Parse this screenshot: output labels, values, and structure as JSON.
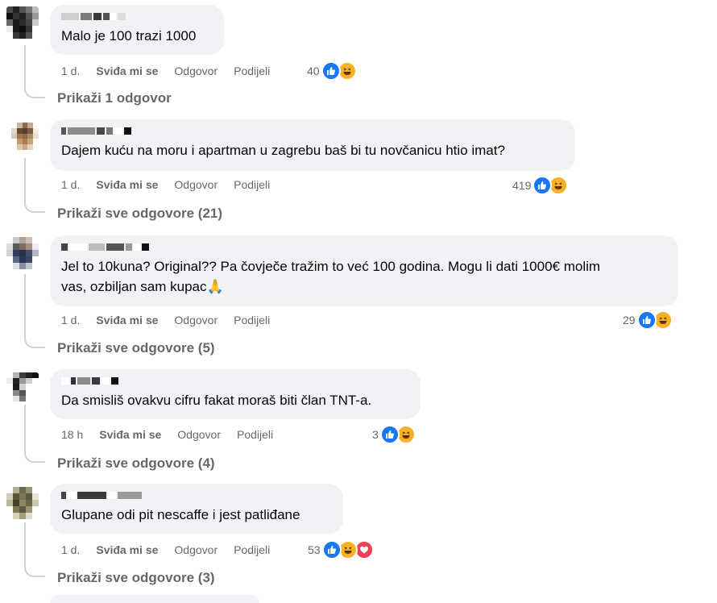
{
  "comments": [
    {
      "text": "Malo je 100 trazi 1000",
      "time": "1 d.",
      "like_label": "Sviđa mi se",
      "reply_label": "Odgovor",
      "share_label": "Podijeli",
      "reaction_count": "40",
      "reactions": [
        "like-icon",
        "haha-icon"
      ],
      "replies_label": "Prikaži 1 odgovor"
    },
    {
      "text": "Dajem kuću na moru i apartman u zagrebu baš bi tu novčanicu htio imat?",
      "time": "1 d.",
      "like_label": "Sviđa mi se",
      "reply_label": "Odgovor",
      "share_label": "Podijeli",
      "reaction_count": "419",
      "reactions": [
        "like-icon",
        "haha-icon"
      ],
      "replies_label": "Prikaži sve odgovore (21)"
    },
    {
      "text_line1": "Jel to 10kuna? Original?? Pa čovječe tražim to već 100 godina. Mogu li dati 1000€ molim",
      "text_line2": "vas, ozbiljan sam kupac🙏",
      "time": "1 d.",
      "like_label": "Sviđa mi se",
      "reply_label": "Odgovor",
      "share_label": "Podijeli",
      "reaction_count": "29",
      "reactions": [
        "like-icon",
        "haha-icon"
      ],
      "replies_label": "Prikaži sve odgovore (5)"
    },
    {
      "text": "Da smisliš ovakvu cifru fakat moraš biti član TNT-a.",
      "time": "18 h",
      "like_label": "Sviđa mi se",
      "reply_label": "Odgovor",
      "share_label": "Podijeli",
      "reaction_count": "3",
      "reactions": [
        "like-icon",
        "haha-icon"
      ],
      "replies_label": "Prikaži sve odgovore (4)"
    },
    {
      "text": "Glupane odi pit nescaffe i jest patliđane",
      "time": "1 d.",
      "like_label": "Sviđa mi se",
      "reply_label": "Odgovor",
      "share_label": "Podijeli",
      "reaction_count": "53",
      "reactions": [
        "like-icon",
        "haha-icon",
        "love-icon"
      ],
      "replies_label": "Prikaži sve odgovore (3)"
    }
  ],
  "colors": {
    "bubble": "#f0f2f5",
    "meta_text": "#65676b",
    "like_blue": "#1877f2",
    "haha_yellow": "#f7b125",
    "love_red": "#f33e58"
  }
}
